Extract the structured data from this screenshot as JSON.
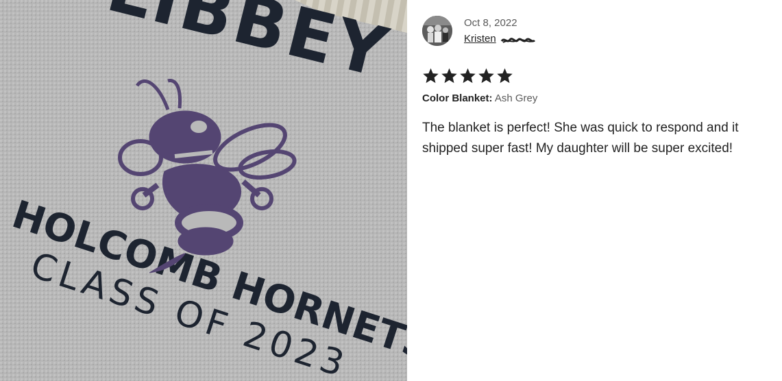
{
  "photo": {
    "icon": "hornet-mascot-blanket-photo",
    "text_top": "LIBBEY",
    "text_line1": "HOLCOMB HORNETS",
    "text_line2": "CLASS OF 2023",
    "colors": {
      "fabric": "#b9b9b9",
      "ink": "#1d2430",
      "mascot": "#544572"
    }
  },
  "review": {
    "date": "Oct 8, 2022",
    "reviewer_name": "Kristen",
    "rating": 5,
    "stars": [
      "★",
      "★",
      "★",
      "★",
      "★"
    ],
    "variation_label": "Color Blanket:",
    "variation_value": "Ash Grey",
    "text": "The blanket is perfect! She was quick to respond and it shipped super fast! My daughter will be super excited!"
  },
  "colors": {
    "star": "#222222",
    "text": "#222222",
    "muted": "#595959"
  }
}
